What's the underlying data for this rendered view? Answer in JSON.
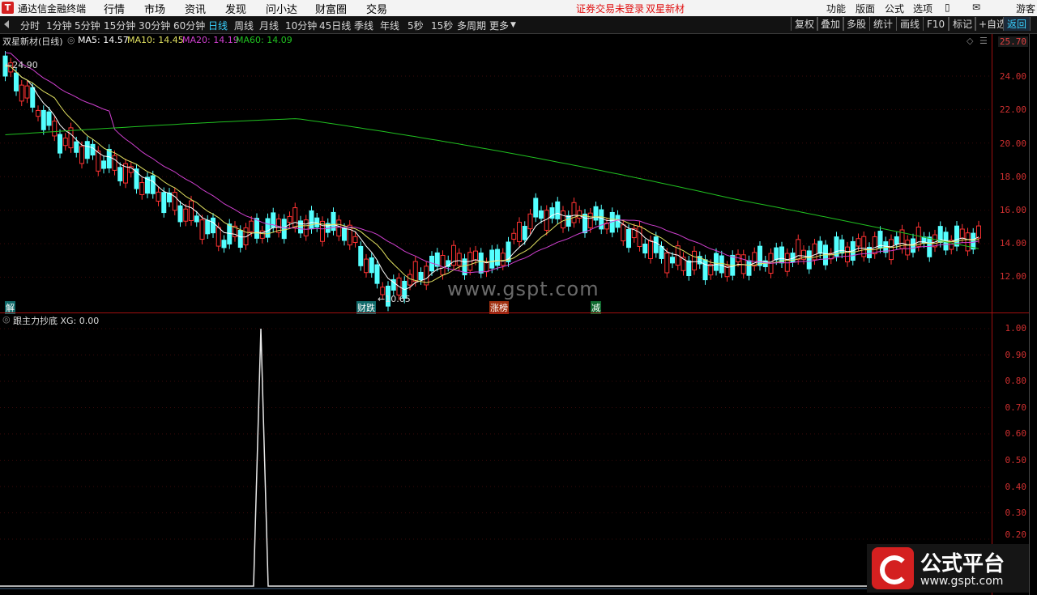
{
  "titlebar": {
    "app_name": "通达信金融终端",
    "menus": [
      "行情",
      "市场",
      "资讯",
      "发现",
      "问小达",
      "财富圈",
      "交易"
    ],
    "notice": "证券交易未登录",
    "stock_link": "双星新材",
    "right_tools": [
      "功能",
      "版面",
      "公式",
      "选项"
    ],
    "guest": "游客"
  },
  "periods": [
    "分时",
    "1分钟",
    "5分钟",
    "15分钟",
    "30分钟",
    "60分钟",
    "日线",
    "周线",
    "月线",
    "10分钟",
    "45日线",
    "季线",
    "年线",
    "5秒",
    "15秒",
    "多周期",
    "更多"
  ],
  "active_period": "日线",
  "right_buttons": [
    "复权",
    "叠加",
    "多股",
    "统计",
    "画线",
    "F10",
    "标记",
    "+自选",
    "返回"
  ],
  "price_legend": {
    "name": "双星新材(日线)",
    "ma5": "MA5: 14.57",
    "ma10": "MA10: 14.45",
    "ma20": "MA20: 14.19",
    "ma60": "MA60: 14.09"
  },
  "indicator_legend": "跟主力抄底  XG: 0.00",
  "price_axis": [
    "25.70",
    "24.00",
    "22.00",
    "20.00",
    "18.00",
    "16.00",
    "14.00",
    "12.00"
  ],
  "ind_axis": [
    "1.00",
    "0.90",
    "0.80",
    "0.70",
    "0.60",
    "0.50",
    "0.40",
    "0.30",
    "0.20"
  ],
  "high_label": "24.90",
  "low_label": "10.65",
  "events": [
    "解",
    "财跌",
    "涨榜",
    "减"
  ],
  "site_watermark": "www.gspt.com",
  "brand_title": "公式平台",
  "brand_url": "www.gspt.com",
  "colors": {
    "up": "#ff3232",
    "down": "#54ffff",
    "ma5": "#ffffff",
    "ma10": "#e0e060",
    "ma20": "#d040d0",
    "ma60": "#20c020",
    "axis": "#a01010"
  }
}
